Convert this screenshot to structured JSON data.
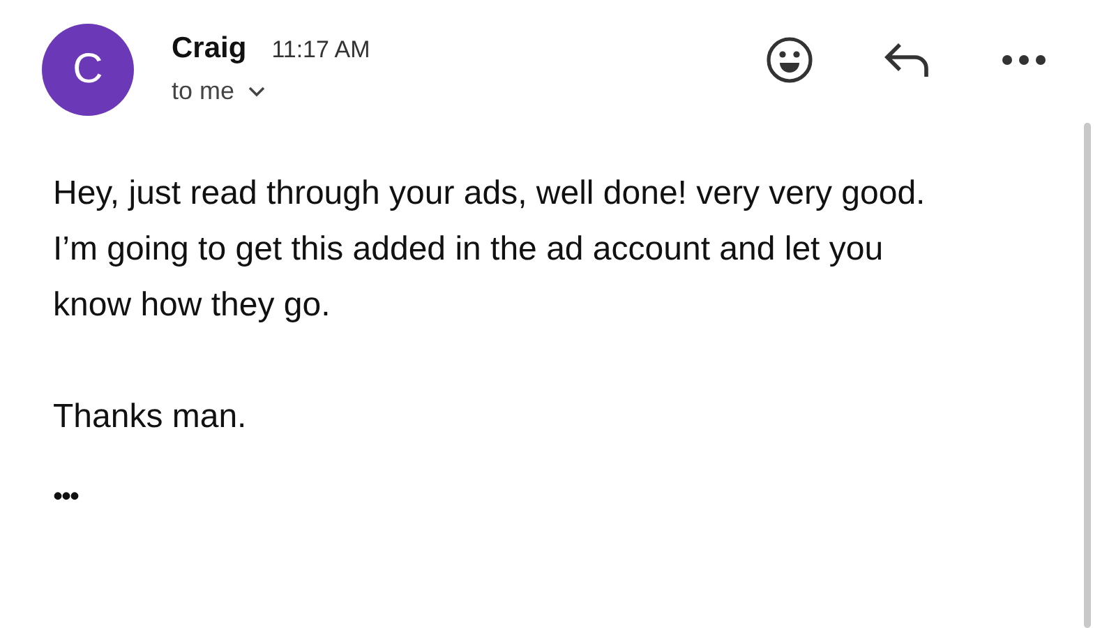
{
  "sender": {
    "initial": "C",
    "name": "Craig",
    "time": "11:17 AM",
    "recipient": "to me"
  },
  "body": [
    "Hey, just read through your ads, well done! very very good. I’m going to get this added in the ad account and let you know how they go.",
    "Thanks man."
  ],
  "more": "•••"
}
